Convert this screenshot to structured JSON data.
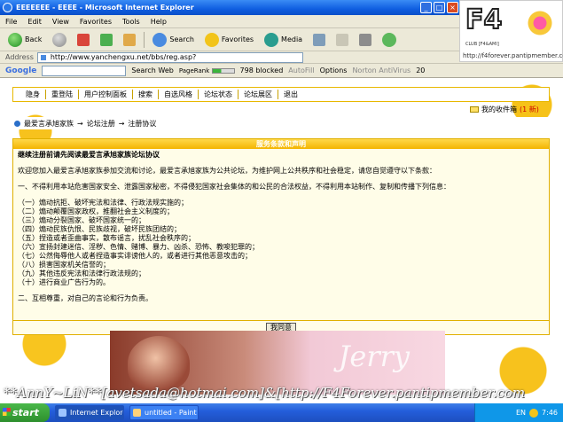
{
  "window": {
    "title": "EEEEEEE - EEEE - Microsoft Internet Explorer"
  },
  "menu": [
    "File",
    "Edit",
    "View",
    "Favorites",
    "Tools",
    "Help"
  ],
  "toolbar": {
    "back": "Back",
    "search": "Search",
    "favorites": "Favorites",
    "media": "Media"
  },
  "address": {
    "label": "Address",
    "url": "http://www.yanchengxu.net/bbs/reg.asp?"
  },
  "googlebar": {
    "logo": "Google",
    "search_web": "Search Web",
    "pagerank": "PageRank",
    "blocked": "798 blocked",
    "autofill": "AutoFill",
    "options": "Options",
    "antivirus": "Norton AntiVirus",
    "count": "20"
  },
  "forum": {
    "nav": [
      "隐身",
      "重登陆",
      "用户控制面板",
      "搜索",
      "自选风格",
      "论坛状态",
      "论坛展区",
      "退出"
    ],
    "inbox_label": "我的收件箱",
    "inbox_count": "(1 新)",
    "breadcrumb": [
      "最爱言承旭家族",
      "论坛注册",
      "注册协议"
    ],
    "breadcrumb_sep": "→",
    "panel_title": "服务条款和声明",
    "agreement_title": "继续注册前请先阅读最爱言承旭家族论坛协议",
    "intro": "欢迎您加入最爱言承旭家族参加交流和讨论，最爱言承旭家族为公共论坛，为维护网上公共秩序和社会稳定，请您自觉遵守以下条款：",
    "clause1": "一、不得利用本站危害国家安全、泄露国家秘密，不得侵犯国家社会集体的和公民的合法权益，不得利用本站制作、复制和传播下列信息：",
    "items": [
      "（一）煽动抗拒、破坏宪法和法律、行政法规实施的；",
      "（二）煽动颠覆国家政权，推翻社会主义制度的；",
      "（三）煽动分裂国家、破坏国家统一的；",
      "（四）煽动民族仇恨、民族歧视，破坏民族团结的；",
      "（五）捏造或者歪曲事实，散布谣言，扰乱社会秩序的；",
      "（六）宣扬封建迷信、淫秽、色情、赌博、暴力、凶杀、恐怖、教唆犯罪的；",
      "（七）公然侮辱他人或者捏造事实诽谤他人的，或者进行其他恶意攻击的；",
      "（八）损害国家机关信誉的；",
      "（九）其他违反宪法和法律行政法规的；",
      "（十）进行商业广告行为的。"
    ],
    "clause2": "二、互相尊重，对自己的言论和行为负责。",
    "agree_button": "我同意"
  },
  "banner": {
    "text_latin": "Jerry"
  },
  "watermark": "**AnnY~LiN**[avetsada@hotmai.com]&[http://F4Forever.pantipmember.com",
  "logo": {
    "title": "F4",
    "sub": "CLUB [F4&AMI]",
    "url": "http://f4forever.pantipmember.com"
  },
  "taskbar": {
    "start": "start",
    "tasks": [
      "Internet Explorer",
      "untitled - Paint"
    ],
    "lang": "EN",
    "clock": "7:46"
  }
}
